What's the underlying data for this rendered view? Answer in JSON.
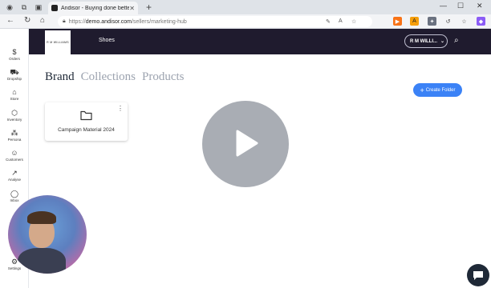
{
  "browser": {
    "tab_title": "Andisor - Buying done better",
    "url_scheme": "https://",
    "url_host": "demo.andisor.com",
    "url_path": "/sellers/marketing-hub"
  },
  "sidebar": {
    "items": [
      {
        "label": "Orders",
        "icon": "dollar-icon"
      },
      {
        "label": "Dropship",
        "icon": "truck-icon"
      },
      {
        "label": "Store",
        "icon": "store-icon"
      },
      {
        "label": "Inventory",
        "icon": "box-icon"
      },
      {
        "label": "Persona",
        "icon": "persona-icon"
      },
      {
        "label": "Customers",
        "icon": "users-icon"
      },
      {
        "label": "Analyse",
        "icon": "chart-icon"
      },
      {
        "label": "Inbox",
        "icon": "chat-icon"
      },
      {
        "label": "Settings",
        "icon": "gear-icon"
      }
    ]
  },
  "header": {
    "logo_text": "R M WILLIAMS",
    "shop_name": "Shoes",
    "user_label": "R M WILLI..."
  },
  "main": {
    "tabs": [
      "Brand",
      "Collections",
      "Products"
    ],
    "active_tab": "Brand",
    "create_button": "Create Folder",
    "folders": [
      {
        "name": "Campaign Material 2024"
      }
    ]
  },
  "colors": {
    "header_bg": "#1f1b2e",
    "accent": "#3b82f6"
  }
}
